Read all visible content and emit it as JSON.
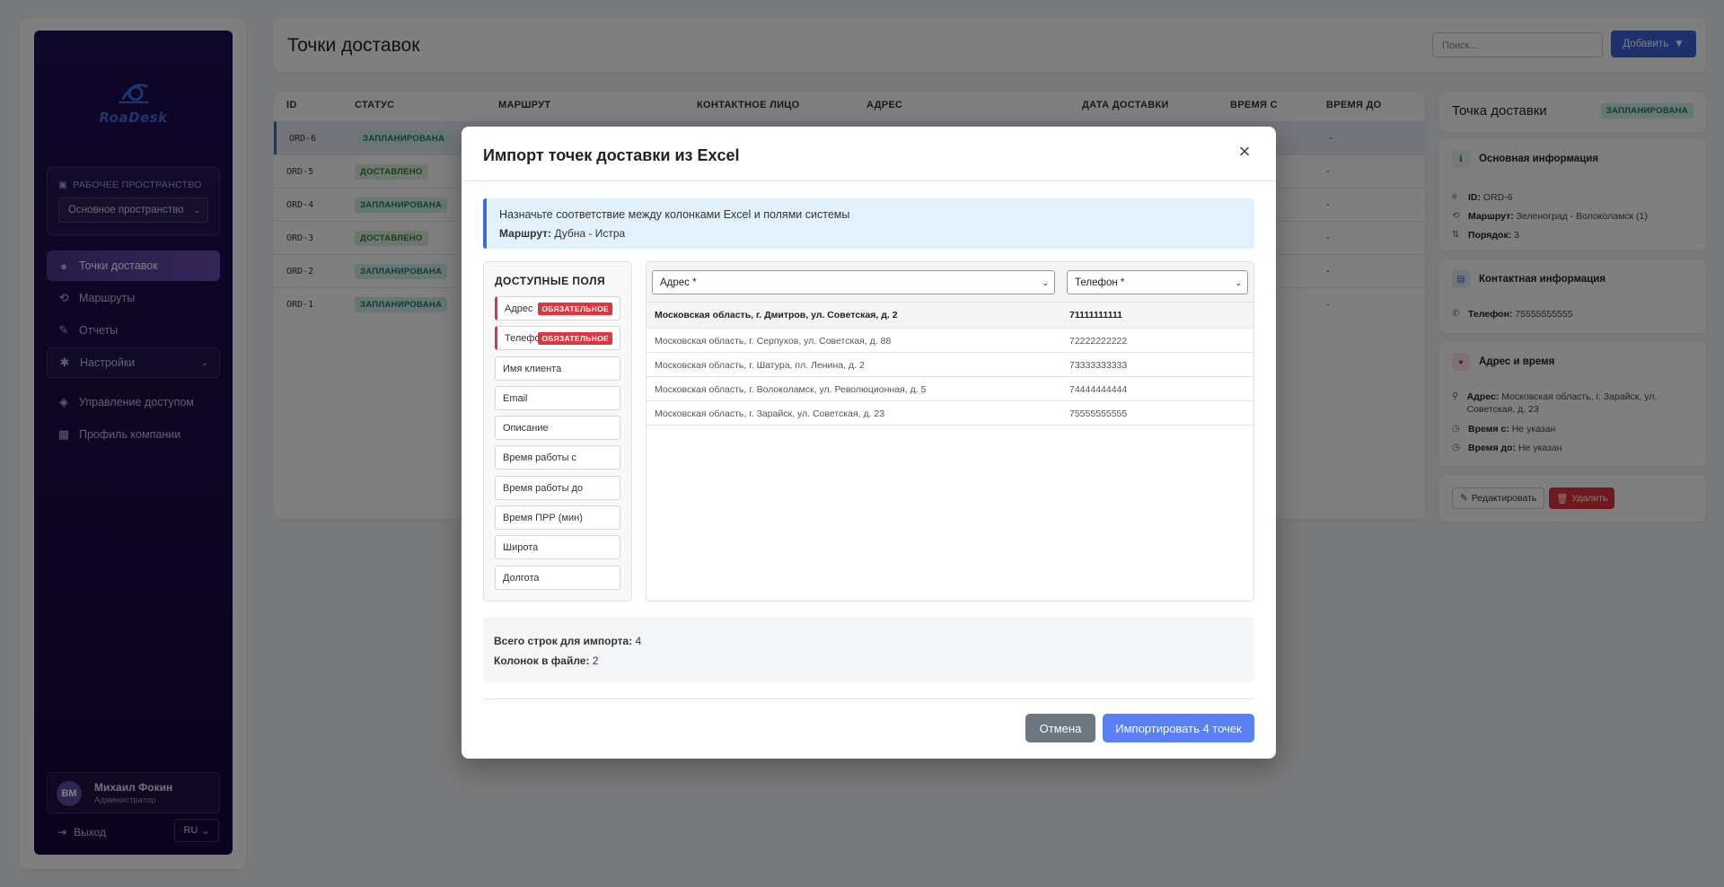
{
  "sidebar": {
    "logo_text": "RoaDesk",
    "workspace_label": "РАБОЧЕЕ ПРОСТРАНСТВО",
    "workspace_value": "Основное пространство",
    "nav": [
      {
        "label": "Точки доставок",
        "icon": "map-pin-icon"
      },
      {
        "label": "Маршруты",
        "icon": "route-icon"
      },
      {
        "label": "Отчеты",
        "icon": "edit-icon"
      },
      {
        "label": "Настройки",
        "icon": "gear-icon"
      },
      {
        "label": "Управление доступом",
        "icon": "shield-icon"
      },
      {
        "label": "Профиль компании",
        "icon": "building-icon"
      }
    ],
    "user": {
      "initials": "ВМ",
      "name": "Михаил Фокин",
      "role": "Администратор"
    },
    "logout_label": "Выход",
    "lang": "RU"
  },
  "header": {
    "title": "Точки доставок",
    "search_placeholder": "Поиск...",
    "add_label": "Добавить"
  },
  "table": {
    "columns": [
      "ID",
      "СТАТУС",
      "МАРШРУТ",
      "КОНТАКТНОЕ ЛИЦО",
      "АДРЕС",
      "ДАТА ДОСТАВКИ",
      "ВРЕМЯ С",
      "ВРЕМЯ ДО"
    ],
    "rows": [
      {
        "id": "ORD-6",
        "status": "ЗАПЛАНИРОВАНА",
        "kind": "plan",
        "time_to": "-"
      },
      {
        "id": "ORD-5",
        "status": "ДОСТАВЛЕНО",
        "kind": "done",
        "time_to": "-"
      },
      {
        "id": "ORD-4",
        "status": "ЗАПЛАНИРОВАНА",
        "kind": "plan",
        "time_to": "-"
      },
      {
        "id": "ORD-3",
        "status": "ДОСТАВЛЕНО",
        "kind": "done",
        "time_to": "-"
      },
      {
        "id": "ORD-2",
        "status": "ЗАПЛАНИРОВАНА",
        "kind": "plan",
        "time_to": "-"
      },
      {
        "id": "ORD-1",
        "status": "ЗАПЛАНИРОВАНА",
        "kind": "plan",
        "time_to": "-"
      }
    ]
  },
  "detail": {
    "title": "Точка доставки",
    "status": "ЗАПЛАНИРОВАНА",
    "basic_title": "Основная информация",
    "id_key": "ID:",
    "id_val": "ORD-6",
    "route_key": "Маршрут:",
    "route_val": "Зеленоград - Волоколамск (1)",
    "order_key": "Порядок:",
    "order_val": "3",
    "contact_title": "Контактная информация",
    "phone_key": "Телефон:",
    "phone_val": "75555555555",
    "addr_title": "Адрес и время",
    "addr_key": "Адрес:",
    "addr_val": "Московская область, г. Зарайск, ул. Советская, д. 23",
    "from_key": "Время с:",
    "from_val": "Не указан",
    "to_key": "Время до:",
    "to_val": "Не указан",
    "edit_label": "Редактировать",
    "delete_label": "Удалить"
  },
  "modal": {
    "title": "Импорт точек доставки из Excel",
    "info_text": "Назначьте соответствие между колонками Excel и полями системы",
    "route_key": "Маршрут:",
    "route_val": "Дубна - Истра",
    "fields_title": "ДОСТУПНЫЕ ПОЛЯ",
    "required_label": "ОБЯЗАТЕЛЬНОЕ",
    "fields": [
      {
        "label": "Адрес",
        "required": true
      },
      {
        "label": "Телефон",
        "required": true
      },
      {
        "label": "Имя клиента",
        "required": false
      },
      {
        "label": "Email",
        "required": false
      },
      {
        "label": "Описание",
        "required": false
      },
      {
        "label": "Время работы с",
        "required": false
      },
      {
        "label": "Время работы до",
        "required": false
      },
      {
        "label": "Время ПРР (мин)",
        "required": false
      },
      {
        "label": "Широта",
        "required": false
      },
      {
        "label": "Долгота",
        "required": false
      }
    ],
    "col1_select": "Адрес *",
    "col2_select": "Телефон *",
    "preview_rows": [
      {
        "address": "Московская область, г. Дмитров, ул. Советская, д. 2",
        "phone": "71111111111"
      },
      {
        "address": "Московская область, г. Серпухов, ул. Советская, д. 88",
        "phone": "72222222222"
      },
      {
        "address": "Московская область, г. Шатура, пл. Ленина, д. 2",
        "phone": "73333333333"
      },
      {
        "address": "Московская область, г. Волоколамск, ул. Революционная, д. 5",
        "phone": "74444444444"
      },
      {
        "address": "Московская область, г. Зарайск, ул. Советская, д. 23",
        "phone": "75555555555"
      }
    ],
    "rows_key": "Всего строк для импорта:",
    "rows_val": "4",
    "cols_key": "Колонок в файле:",
    "cols_val": "2",
    "cancel_label": "Отмена",
    "import_label": "Импортировать 4 точек"
  },
  "colors": {
    "accent": "#3d63d6",
    "import_button": "#5a7ff0",
    "required": "#e0343f",
    "sidebar_bg": "#1e0e4f"
  }
}
